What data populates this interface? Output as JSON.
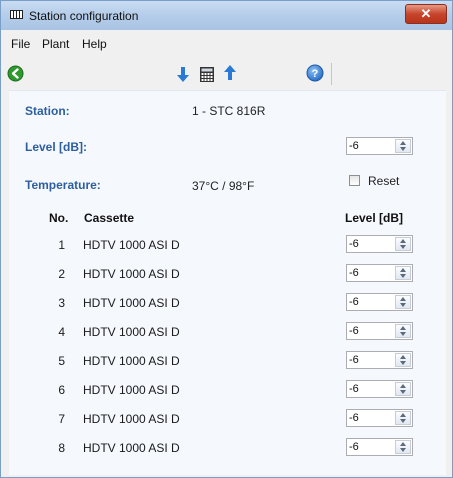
{
  "window": {
    "title": "Station configuration",
    "close_glyph": "✕"
  },
  "menu": {
    "items": [
      "File",
      "Plant",
      "Help"
    ]
  },
  "toolbar": {
    "icons": [
      "back-icon",
      "download-arrow-icon",
      "calculator-icon",
      "upload-arrow-icon",
      "help-icon"
    ]
  },
  "station": {
    "label": "Station:",
    "value": "1 - STC 816R"
  },
  "level": {
    "label": "Level [dB]:",
    "value": "-6"
  },
  "temperature": {
    "label": "Temperature:",
    "value": "37°C / 98°F"
  },
  "reset": {
    "label": "Reset",
    "checked": false
  },
  "table": {
    "headers": {
      "no": "No.",
      "cassette": "Cassette",
      "level": "Level [dB]"
    },
    "rows": [
      {
        "no": "1",
        "cassette": "HDTV 1000 ASI D",
        "level": "-6"
      },
      {
        "no": "2",
        "cassette": "HDTV 1000 ASI D",
        "level": "-6"
      },
      {
        "no": "3",
        "cassette": "HDTV 1000 ASI D",
        "level": "-6"
      },
      {
        "no": "4",
        "cassette": "HDTV 1000 ASI D",
        "level": "-6"
      },
      {
        "no": "5",
        "cassette": "HDTV 1000 ASI D",
        "level": "-6"
      },
      {
        "no": "6",
        "cassette": "HDTV 1000 ASI D",
        "level": "-6"
      },
      {
        "no": "7",
        "cassette": "HDTV 1000 ASI D",
        "level": "-6"
      },
      {
        "no": "8",
        "cassette": "HDTV 1000 ASI D",
        "level": "-6"
      }
    ]
  },
  "colors": {
    "label_blue": "#2d5f9e",
    "toolbar_blue": "#2a7ad5",
    "back_green": "#2e9a2e",
    "close_red": "#c7452c"
  }
}
